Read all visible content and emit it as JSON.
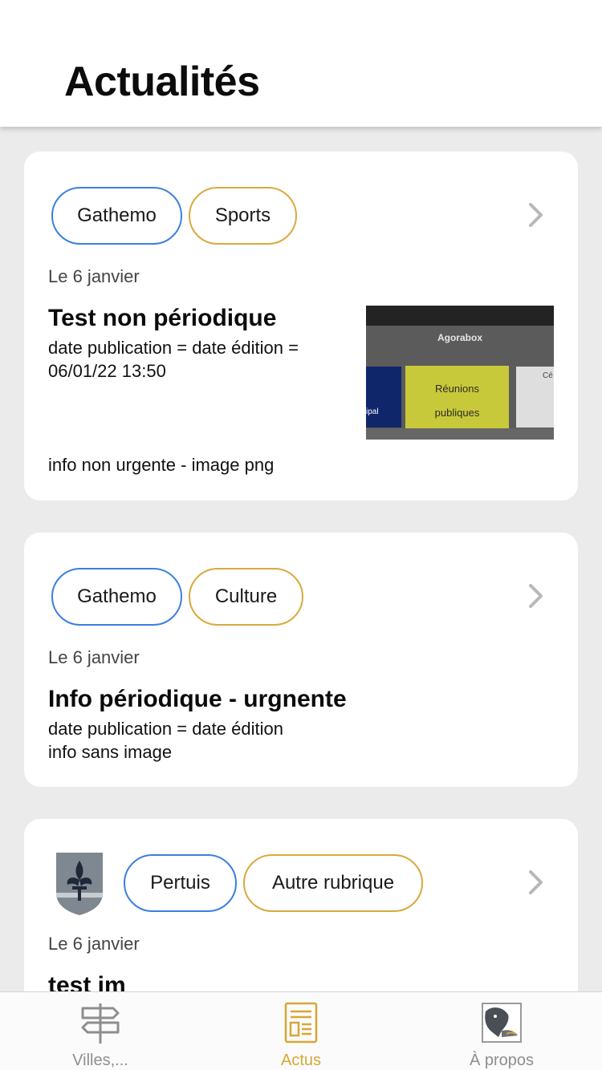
{
  "header": {
    "title": "Actualités"
  },
  "cards": [
    {
      "commune": "Gathemo",
      "category": "Sports",
      "date": "Le 6 janvier",
      "title": "Test non périodique",
      "desc_line1": "date publication = date édition =",
      "desc_line2": "06/01/22 13:50",
      "footer": "info non urgente - image png",
      "thumbnail": {
        "brand": "Agorabox",
        "tile_left": "ipal",
        "tile_center_line1": "Réunions",
        "tile_center_line2": "publiques",
        "tile_right": "Cé"
      }
    },
    {
      "commune": "Gathemo",
      "category": "Culture",
      "date": "Le 6 janvier",
      "title": "Info périodique - urgnente",
      "desc_line1": "date publication = date édition",
      "desc_line2": "info sans image"
    },
    {
      "commune": "Pertuis",
      "category": "Autre rubrique",
      "date": "Le 6 janvier",
      "title": "test im"
    }
  ],
  "tabs": [
    {
      "label": "Villes,...",
      "icon": "signpost-icon"
    },
    {
      "label": "Actus",
      "icon": "newspaper-icon",
      "active": true
    },
    {
      "label": "À propos",
      "icon": "bird-logo-icon"
    }
  ],
  "colors": {
    "commune_chip_border": "#3b7fe0",
    "category_chip_border": "#d8aa3e",
    "active_tab": "#d8a634",
    "inactive_tab": "#8e8e8e",
    "background": "#ebebeb"
  }
}
